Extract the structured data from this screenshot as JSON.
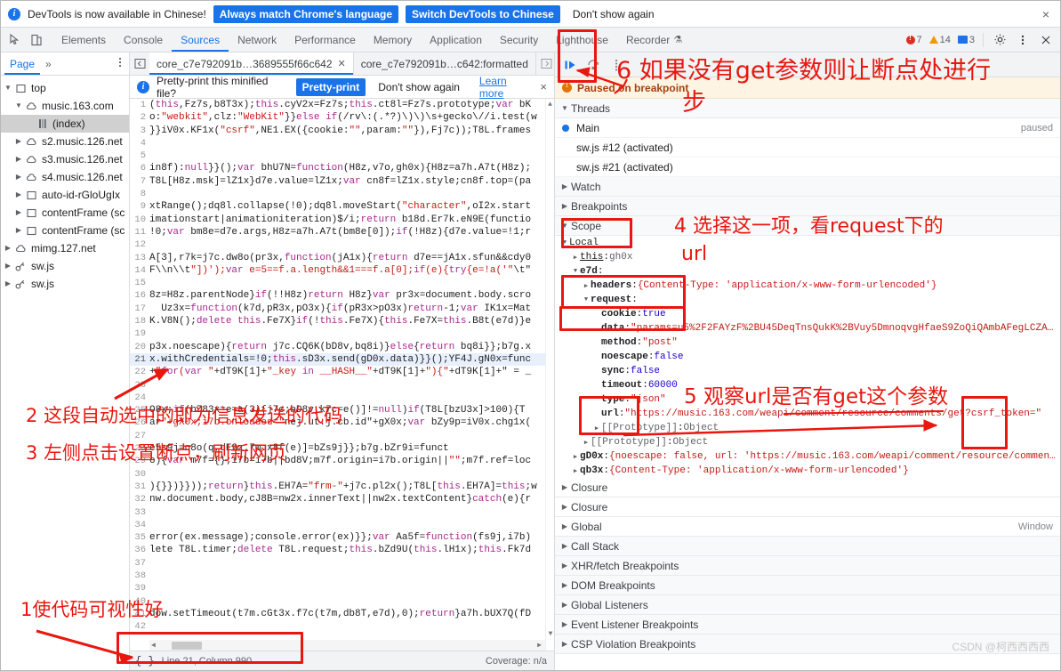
{
  "banner": {
    "icon": "info-icon",
    "message": "DevTools is now available in Chinese!",
    "btn_always": "Always match Chrome's language",
    "btn_switch": "Switch DevTools to Chinese",
    "btn_dismiss": "Don't show again",
    "close": "×",
    "accent": "#1a73e8"
  },
  "toolbar": {
    "inspect_icon": "inspect-element-icon",
    "device_icon": "device-toolbar-icon",
    "tabs": [
      {
        "label": "Elements",
        "active": false
      },
      {
        "label": "Console",
        "active": false
      },
      {
        "label": "Sources",
        "active": true
      },
      {
        "label": "Network",
        "active": false
      },
      {
        "label": "Performance",
        "active": false
      },
      {
        "label": "Memory",
        "active": false
      },
      {
        "label": "Application",
        "active": false
      },
      {
        "label": "Security",
        "active": false
      },
      {
        "label": "Lighthouse",
        "active": false
      },
      {
        "label": "Recorder",
        "active": false
      }
    ],
    "recorder_badge": "⚗",
    "errors": "7",
    "warnings": "14",
    "messages": "3",
    "settings_icon": "gear-icon",
    "kebab_icon": "more-options-icon",
    "close_icon": "close-icon"
  },
  "navigator": {
    "tab": "Page",
    "more": "»",
    "kebab_icon": "more-options-icon",
    "tree": [
      {
        "label": "top",
        "depth": 0,
        "twisty": "▼",
        "icon": "frame-icon",
        "selected": false
      },
      {
        "label": "music.163.com",
        "depth": 1,
        "twisty": "▼",
        "icon": "cloud-icon",
        "selected": false
      },
      {
        "label": "(index)",
        "depth": 2,
        "twisty": "",
        "icon": "document-icon",
        "selected": true
      },
      {
        "label": "s2.music.126.net",
        "depth": 1,
        "twisty": "▶",
        "icon": "cloud-icon",
        "selected": false
      },
      {
        "label": "s3.music.126.net",
        "depth": 1,
        "twisty": "▶",
        "icon": "cloud-icon",
        "selected": false
      },
      {
        "label": "s4.music.126.net",
        "depth": 1,
        "twisty": "▶",
        "icon": "cloud-icon",
        "selected": false
      },
      {
        "label": "auto-id-rGloUgIx",
        "depth": 1,
        "twisty": "▶",
        "icon": "frame-icon",
        "selected": false
      },
      {
        "label": "contentFrame (sc",
        "depth": 1,
        "twisty": "▶",
        "icon": "frame-icon",
        "selected": false
      },
      {
        "label": "contentFrame (sc",
        "depth": 1,
        "twisty": "▶",
        "icon": "frame-icon",
        "selected": false
      },
      {
        "label": "mimg.127.net",
        "depth": 0,
        "twisty": "▶",
        "icon": "cloud-icon",
        "selected": false
      },
      {
        "label": "sw.js",
        "depth": 0,
        "twisty": "▶",
        "icon": "worker-icon",
        "selected": false
      },
      {
        "label": "sw.js",
        "depth": 0,
        "twisty": "▶",
        "icon": "worker-icon",
        "selected": false
      }
    ]
  },
  "editor": {
    "tabs": [
      {
        "label": "core_c7e792091b…3689555f66c642",
        "active": true,
        "closable": true
      },
      {
        "label": "core_c7e792091b…c642:formatted",
        "active": false,
        "closable": false
      }
    ],
    "prettyprint_banner": {
      "message": "Pretty-print this minified file?",
      "btn_pretty": "Pretty-print",
      "btn_dismiss": "Don't show again",
      "learn_more": "Learn more",
      "close": "×"
    },
    "code_lines": [
      {
        "n": 1,
        "text": "(this,Fz7s,b8T3x);this.cyV2x=Fz7s;this.ct8l=Fz7s.prototype;var bK"
      },
      {
        "n": 2,
        "text": "o:\"webkit\",clz:\"WebKit\"}}else if(/rv\\:(.*?)\\)\\)\\s+gecko\\//i.test(w"
      },
      {
        "n": 3,
        "text": "}}iV0x.KF1x(\"csrf\",NE1.EX({cookie:\"\",param:\"\"}),Fj7c));T8L.frames"
      },
      {
        "n": 4,
        "text": ""
      },
      {
        "n": 5,
        "text": ""
      },
      {
        "n": 6,
        "text": "in8f):null}}();var bhU7N=function(H8z,v7o,gh0x){H8z=a7h.A7t(H8z);"
      },
      {
        "n": 7,
        "text": "T8L[H8z.msk]=lZ1x}d7e.value=lZ1x;var cn8f=lZ1x.style;cn8f.top=(pa"
      },
      {
        "n": 8,
        "text": ""
      },
      {
        "n": 9,
        "text": "xtRange();dq8l.collapse(!0);dq8l.moveStart(\"character\",oI2x.start"
      },
      {
        "n": 10,
        "text": "imationstart|animationiteration)$/i;return b18d.Er7k.eN9E(functio"
      },
      {
        "n": 11,
        "text": "!0;var bm8e=d7e.args,H8z=a7h.A7t(bm8e[0]);if(!H8z){d7e.value=!1;r"
      },
      {
        "n": 12,
        "text": ""
      },
      {
        "n": 13,
        "text": "A[3],r7k=j7c.dw8o(pr3x,function(jA1x){return d7e==jA1x.sfun&&cdy0"
      },
      {
        "n": 14,
        "text": "F\\\\n\\\\t\"])');var e=5==f.a.length&&1===f.a[0];if(e){try{e=!a('\"\\t\""
      },
      {
        "n": 15,
        "text": ""
      },
      {
        "n": 16,
        "text": "8z=H8z.parentNode}if(!!H8z)return H8z}var pr3x=document.body.scro"
      },
      {
        "n": 17,
        "text": "  Uz3x=function(k7d,pR3x,pO3x){if(pR3x>pO3x)return-1;var IK1x=Mat"
      },
      {
        "n": 18,
        "text": "K.V8N();delete this.Fe7X}if(!this.Fe7X){this.Fe7X=this.B8t(e7d)}e"
      },
      {
        "n": 19,
        "text": ""
      },
      {
        "n": 20,
        "text": "p3x.noescape){return j7c.CQ6K(bD8v,bq8i)}else{return bq8i}};b7g.x"
      },
      {
        "n": 21,
        "text": "x.withCredentials=!0;this.sD3x.send(gD0x.data)}}();YF4J.gN0x=func",
        "highlight": true
      },
      {
        "n": 22,
        "text": "+\"for(var \"+dT9K[1]+\"_key in __HASH__\"+dT9K[1]+\"){\"+dT9K[1]+\" = _"
      },
      {
        "n": 23,
        "text": ""
      },
      {
        "n": 24,
        "text": ""
      },
      {
        "n": 25,
        "text": "O8x;if(bZ83x=e=a(3){j7c;bD8v,k7c=e()]!=null)if(T8L[bzU3x]>100){T"
      },
      {
        "n": 26,
        "text": "ar\"+gX0x;i7b.onloaded=\"nej.ut.j.cb.id\"+gX0x;var bZy9p=iV0x.chg1x("
      },
      {
        "n": 27,
        "text": ""
      },
      {
        "n": 28,
        "text": "e5s9j=q8o(q,dE9z.7m.x8f(e)]=bZs9j}};b7g.bZr9i=funct"
      },
      {
        "n": 29,
        "text": "o){var m7f={};i7b=i7b||bd8V;m7f.origin=i7b.origin||\"\";m7f.ref=loc"
      },
      {
        "n": 30,
        "text": ""
      },
      {
        "n": 31,
        "text": "){}})}}));return}this.EH7A=\"frm-\"+j7c.pl2x();T8L[this.EH7A]=this;w"
      },
      {
        "n": 32,
        "text": "nw.document.body,cJ8B=nw2x.innerText||nw2x.textContent}catch(e){r"
      },
      {
        "n": 33,
        "text": ""
      },
      {
        "n": 34,
        "text": ""
      },
      {
        "n": 35,
        "text": "error(ex.message);console.error(ex)}};var Aa5f=function(fs9j,i7b)"
      },
      {
        "n": 36,
        "text": "lete T8L.timer;delete T8L.request;this.bZd9U(this.lH1x);this.Fk7d"
      },
      {
        "n": 37,
        "text": ""
      },
      {
        "n": 38,
        "text": ""
      },
      {
        "n": 39,
        "text": ""
      },
      {
        "n": 40,
        "text": ""
      },
      {
        "n": 41,
        "text": "dow.setTimeout(t7m.cGt3x.f7c(t7m,db8T,e7d),0);return}a7h.bUX7Q(fD"
      },
      {
        "n": 42,
        "text": ""
      }
    ],
    "status": {
      "braces_icon": "format-braces-icon",
      "position": "Line 21, Column 990",
      "coverage": "Coverage: n/a"
    }
  },
  "debugger": {
    "toolbar": {
      "resume_icon": "resume-script-icon",
      "step_over_icon": "step-over-icon",
      "step_icon": "step-into-icon"
    },
    "paused": {
      "icon": "pause-warning-icon",
      "text": "Paused on breakpoint"
    },
    "threads": {
      "title": "Threads",
      "items": [
        {
          "label": "Main",
          "status": "paused",
          "dot": true
        },
        {
          "label": "sw.js #12 (activated)",
          "status": "",
          "dot": false
        },
        {
          "label": "sw.js #21 (activated)",
          "status": "",
          "dot": false
        }
      ]
    },
    "sections": [
      {
        "title": "Watch",
        "caret": "▶"
      },
      {
        "title": "Breakpoints",
        "caret": "▶"
      },
      {
        "title": "Scope",
        "caret": "▼"
      }
    ],
    "scope": [
      {
        "indent": 0,
        "arrow": "▼",
        "name": "Local",
        "sep": "",
        "value": "",
        "style": "plain"
      },
      {
        "indent": 1,
        "arrow": "▶",
        "name": "this",
        "sep": ": ",
        "value": "gh0x",
        "style": "link"
      },
      {
        "indent": 1,
        "arrow": "▼",
        "name": "e7d",
        "sep": ":",
        "value": "",
        "style": "bold"
      },
      {
        "indent": 2,
        "arrow": "▶",
        "name": "headers",
        "sep": ": ",
        "value": "{Content-Type: 'application/x-www-form-urlencoded'}",
        "style": "bold"
      },
      {
        "indent": 2,
        "arrow": "▼",
        "name": "request",
        "sep": ":",
        "value": "",
        "style": "bold"
      },
      {
        "indent": 3,
        "arrow": "",
        "name": "cookie",
        "sep": ": ",
        "value": "true",
        "style": "bold"
      },
      {
        "indent": 3,
        "arrow": "",
        "name": "data",
        "sep": ": ",
        "value": "\"params=u5%2F2FAYzF%2BU45DeqTnsQukK%2BVuy5DmnoqvgHfaeS9ZoQiQAmbAFegLCZA…",
        "style": "bold"
      },
      {
        "indent": 3,
        "arrow": "",
        "name": "method",
        "sep": ": ",
        "value": "\"post\"",
        "style": "bold"
      },
      {
        "indent": 3,
        "arrow": "",
        "name": "noescape",
        "sep": ": ",
        "value": "false",
        "style": "bold"
      },
      {
        "indent": 3,
        "arrow": "",
        "name": "sync",
        "sep": ": ",
        "value": "false",
        "style": "bold"
      },
      {
        "indent": 3,
        "arrow": "",
        "name": "timeout",
        "sep": ": ",
        "value": "60000",
        "style": "bold"
      },
      {
        "indent": 3,
        "arrow": "",
        "name": "type",
        "sep": ": ",
        "value": "\"json\"",
        "style": "bold"
      },
      {
        "indent": 3,
        "arrow": "",
        "name": "url",
        "sep": ": ",
        "value": "\"https://music.163.com/weapi/comment/resource/comments/get?csrf_token=\"",
        "style": "bold"
      },
      {
        "indent": 3,
        "arrow": "▶",
        "name": "[[Prototype]]",
        "sep": ": ",
        "value": "Object",
        "style": "proto"
      },
      {
        "indent": 2,
        "arrow": "▶",
        "name": "[[Prototype]]",
        "sep": ": ",
        "value": "Object",
        "style": "proto"
      },
      {
        "indent": 1,
        "arrow": "▶",
        "name": "gD0x",
        "sep": ": ",
        "value": "{noescape: false, url: 'https://music.163.com/weapi/comment/resource/commen…",
        "style": "bold"
      },
      {
        "indent": 1,
        "arrow": "▶",
        "name": "qb3x",
        "sep": ": ",
        "value": "{Content-Type: 'application/x-www-form-urlencoded'}",
        "style": "bold"
      }
    ],
    "scope_tail": [
      {
        "title": "Closure",
        "caret": "▶",
        "right": ""
      },
      {
        "title": "Closure",
        "caret": "▶",
        "right": ""
      },
      {
        "title": "Global",
        "caret": "▶",
        "right": "Window"
      }
    ],
    "bottom_sections": [
      {
        "title": "Call Stack",
        "caret": "▶"
      },
      {
        "title": "XHR/fetch Breakpoints",
        "caret": "▶"
      },
      {
        "title": "DOM Breakpoints",
        "caret": "▶"
      },
      {
        "title": "Global Listeners",
        "caret": "▶"
      },
      {
        "title": "Event Listener Breakpoints",
        "caret": "▶"
      },
      {
        "title": "CSP Violation Breakpoints",
        "caret": "▶"
      }
    ]
  },
  "annotations": {
    "color": "#e8170f",
    "note1": "1使代码可视性好",
    "note2": "2 这段自动选中的即为信息发送的代码",
    "note3": "3 左侧点击设置断点，刷新网页",
    "note4a": "4 选择这一项，看request下的",
    "note4b": "url",
    "note5": "5 观察url是否有get这个参数",
    "note6a": "6 如果没有get参数则让断点处进行",
    "note6b": "步"
  },
  "watermark": "CSDN @柯西西西西"
}
